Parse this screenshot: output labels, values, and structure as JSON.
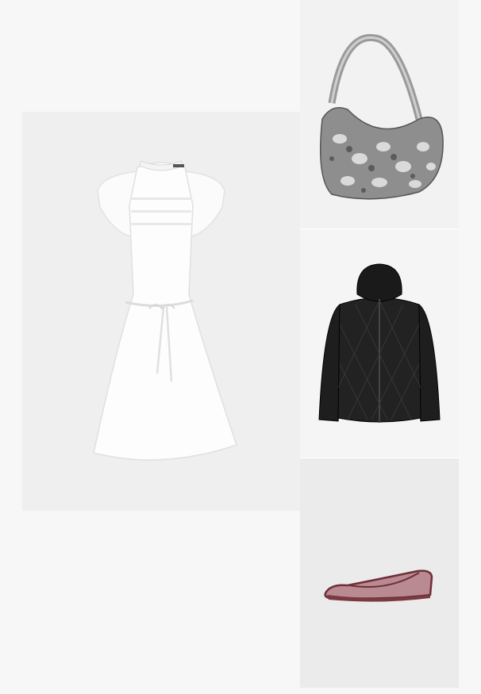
{
  "outfit": {
    "items": [
      {
        "product": "dress",
        "color": "#ffffff",
        "icon": "white-dress-image"
      },
      {
        "product": "bag",
        "color": "#8a8a8a",
        "icon": "snakeskin-shoulder-bag-image"
      },
      {
        "product": "jacket",
        "color": "#1c1c1c",
        "icon": "black-quilted-jacket-image"
      },
      {
        "product": "shoes",
        "color": "#7a3a42",
        "icon": "burgundy-mesh-flat-image"
      }
    ]
  }
}
